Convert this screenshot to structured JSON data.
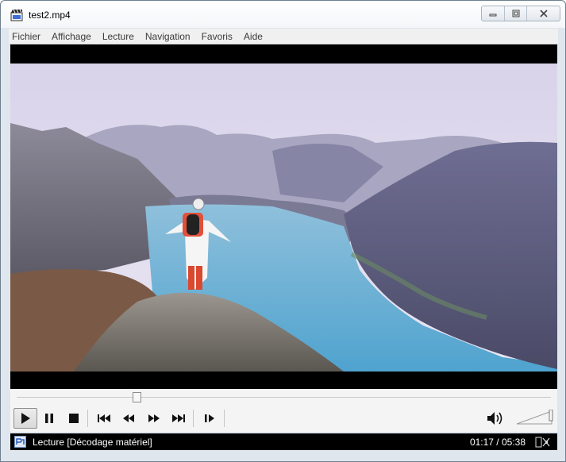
{
  "window": {
    "title": "test2.mp4",
    "icon": "clapperboard-icon",
    "controls": [
      "minimize-icon",
      "maximize-icon",
      "close-icon"
    ]
  },
  "menu": {
    "items": [
      "Fichier",
      "Affichage",
      "Lecture",
      "Navigation",
      "Favoris",
      "Aide"
    ]
  },
  "playback": {
    "progress": 0.2262,
    "volume": 1.0,
    "buttons": [
      "play-icon",
      "pause-icon",
      "stop-icon",
      "skip-previous-icon",
      "rewind-icon",
      "fast-forward-icon",
      "skip-next-icon",
      "frame-step-icon"
    ]
  },
  "status": {
    "text": "Lecture [Décodage matériel]",
    "time": "01:17 / 05:38"
  },
  "colors": {
    "accent": "#000000",
    "background": "#f4f4f4"
  }
}
